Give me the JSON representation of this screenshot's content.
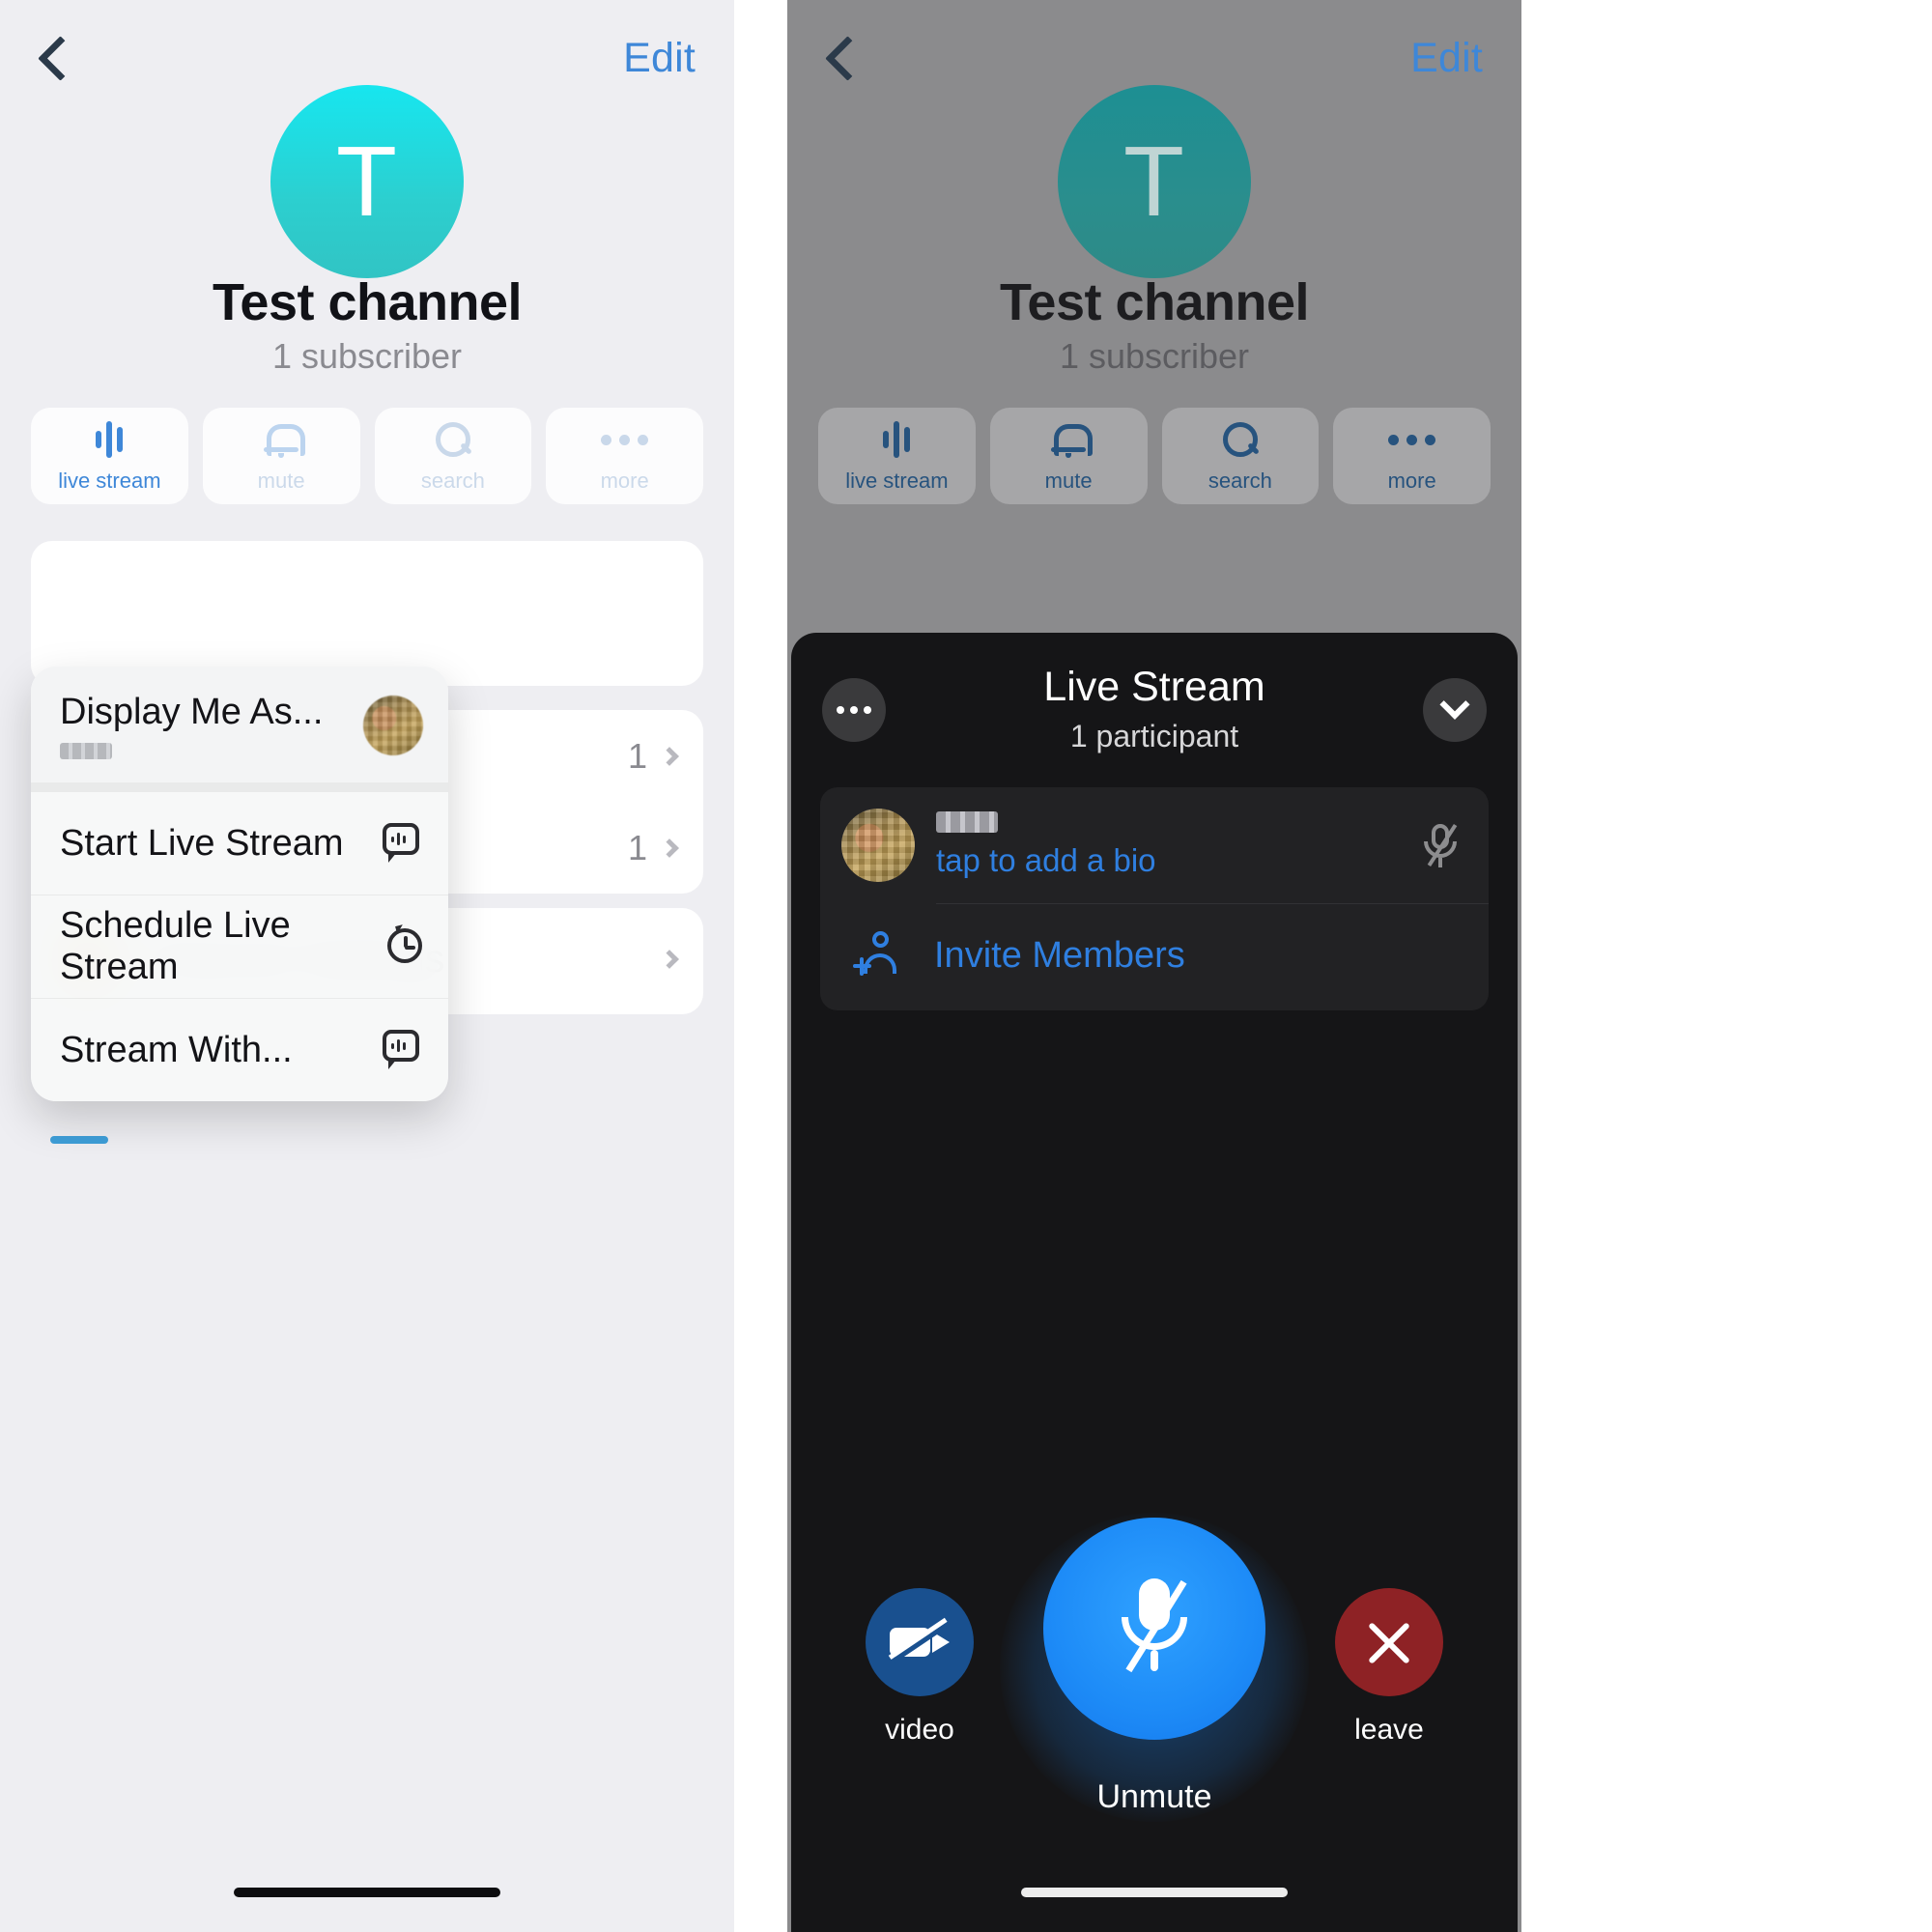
{
  "left_panel": {
    "nav": {
      "back_icon": "back-chevron-icon",
      "edit_label": "Edit"
    },
    "profile": {
      "avatar_letter": "T",
      "avatar_color": "#21d8de",
      "title": "Test channel",
      "subtitle": "1 subscriber"
    },
    "actions": [
      {
        "icon": "waveform-icon",
        "label": "live stream",
        "active": true
      },
      {
        "icon": "bell-icon",
        "label": "mute",
        "active": false
      },
      {
        "icon": "search-icon",
        "label": "search",
        "active": false
      },
      {
        "icon": "ellipsis-icon",
        "label": "more",
        "active": false
      }
    ],
    "rows": [
      {
        "value": "1"
      },
      {
        "value": "1"
      }
    ],
    "settings_row": {
      "icon": "sliders-icon",
      "icon_color": "#f2a033",
      "label": "Channel Settings"
    },
    "context_menu": {
      "header": {
        "title": "Display Me As...",
        "subtitle_redacted": true,
        "avatar": "user-avatar"
      },
      "items": [
        {
          "label": "Start Live Stream",
          "icon": "live-stream-icon"
        },
        {
          "label": "Schedule Live Stream",
          "icon": "clock-icon"
        },
        {
          "label": "Stream With...",
          "icon": "live-stream-icon"
        }
      ]
    }
  },
  "right_panel": {
    "nav": {
      "back_icon": "back-chevron-icon",
      "edit_label": "Edit"
    },
    "profile": {
      "avatar_letter": "T",
      "avatar_color": "#2a8e8d",
      "title": "Test channel",
      "subtitle": "1 subscriber"
    },
    "actions": [
      {
        "icon": "waveform-icon",
        "label": "live stream"
      },
      {
        "icon": "bell-icon",
        "label": "mute"
      },
      {
        "icon": "search-icon",
        "label": "search"
      },
      {
        "icon": "ellipsis-icon",
        "label": "more"
      }
    ],
    "live_stream": {
      "more_icon": "ellipsis-icon",
      "collapse_icon": "chevron-down-icon",
      "title": "Live Stream",
      "subtitle": "1 participant",
      "participant": {
        "avatar": "user-avatar",
        "name_redacted": true,
        "bio_prompt": "tap to add a bio",
        "mic_icon": "mic-off-icon"
      },
      "invite": {
        "icon": "person-add-icon",
        "label": "Invite Members"
      },
      "controls": {
        "video": {
          "icon": "video-off-icon",
          "label": "video",
          "color": "#19508f"
        },
        "mute": {
          "icon": "mic-off-icon",
          "label": "Unmute",
          "color": "#1d8bf7"
        },
        "leave": {
          "icon": "close-icon",
          "label": "leave",
          "color": "#8e2225"
        }
      }
    }
  }
}
